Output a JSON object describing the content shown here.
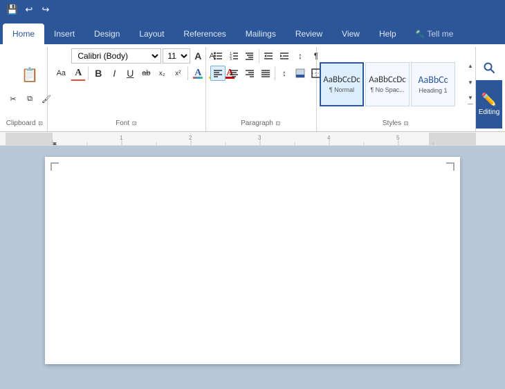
{
  "tabs": [
    {
      "id": "home",
      "label": "Home",
      "active": true
    },
    {
      "id": "insert",
      "label": "Insert",
      "active": false
    },
    {
      "id": "design",
      "label": "Design",
      "active": false
    },
    {
      "id": "layout",
      "label": "Layout",
      "active": false
    },
    {
      "id": "references",
      "label": "References",
      "active": false
    },
    {
      "id": "mailings",
      "label": "Mailings",
      "active": false
    },
    {
      "id": "review",
      "label": "Review",
      "active": false
    },
    {
      "id": "view",
      "label": "View",
      "active": false
    },
    {
      "id": "help",
      "label": "Help",
      "active": false
    },
    {
      "id": "tellme",
      "label": "Tell me",
      "active": false
    }
  ],
  "font": {
    "name": "Calibri (Body)",
    "size": "11",
    "grow_label": "A",
    "shrink_label": "A",
    "case_label": "Aa",
    "clear_label": "A"
  },
  "format": {
    "bold": "B",
    "italic": "I",
    "underline": "U",
    "strikethrough": "ab",
    "subscript": "x₂",
    "superscript": "x²",
    "text_effects": "A",
    "highlight": "A",
    "font_color": "A"
  },
  "paragraph": {
    "bullets_label": "≡",
    "numbering_label": "≡",
    "multilevel_label": "≡",
    "decrease_indent": "⊢",
    "increase_indent": "⊣",
    "sort_label": "↕",
    "show_para": "¶",
    "align_left": "≡",
    "align_center": "≡",
    "align_right": "≡",
    "justify": "≡",
    "line_spacing": "↕",
    "shading": "▭",
    "borders": "▭",
    "label": "Paragraph",
    "expander": "⊡"
  },
  "styles": {
    "label": "Styles",
    "expander": "⊡",
    "items": [
      {
        "id": "normal",
        "preview_text": "AaBbCcDc",
        "name": "¶ Normal",
        "active": true
      },
      {
        "id": "no_spacing",
        "preview_text": "AaBbCcDc",
        "name": "¶ No Spac...",
        "active": false
      },
      {
        "id": "heading1",
        "preview_text": "AaBbCc",
        "name": "Heading 1",
        "active": false
      }
    ],
    "scroll_up": "▲",
    "scroll_down": "▼",
    "more": "▼"
  },
  "search": {
    "icon": "🔍"
  },
  "editing": {
    "label": "Editing"
  },
  "font_group_label": "Font",
  "font_expander": "⊡"
}
